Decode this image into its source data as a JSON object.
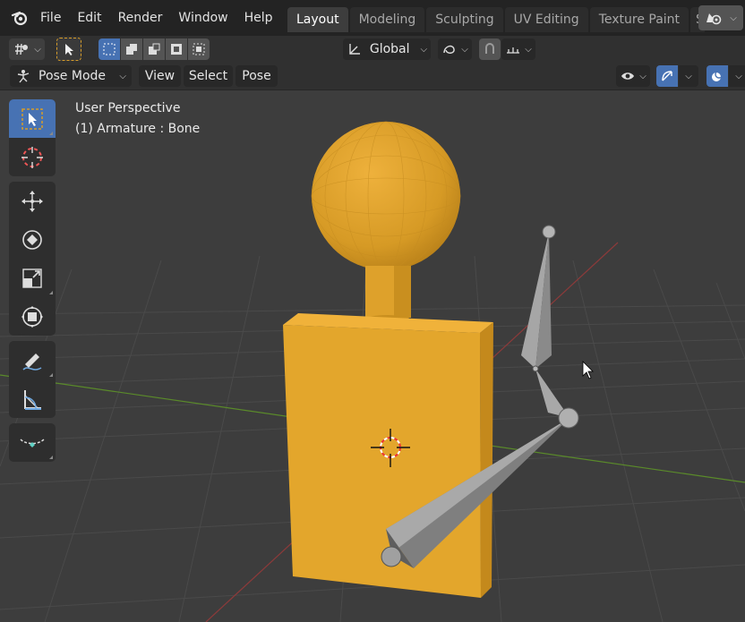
{
  "menu": {
    "file": "File",
    "edit": "Edit",
    "render": "Render",
    "window": "Window",
    "help": "Help"
  },
  "workspaces": [
    {
      "label": "Layout",
      "active": true
    },
    {
      "label": "Modeling"
    },
    {
      "label": "Sculpting"
    },
    {
      "label": "UV Editing"
    },
    {
      "label": "Texture Paint"
    },
    {
      "label": "S"
    }
  ],
  "header": {
    "transform_orientation": "Global",
    "mode": "Pose Mode",
    "view": "View",
    "select": "Select",
    "pose": "Pose"
  },
  "viewport": {
    "perspective": "User Perspective",
    "object_info": "(1) Armature : Bone"
  },
  "colors": {
    "accent": "#4772b3",
    "object": "#e3a62c",
    "bone": "#9d9d9d",
    "background": "#3d3d3d"
  },
  "icons": [
    "blender-logo-icon",
    "editor-type-icon",
    "select-tool-icon",
    "select-mode-icons",
    "transform-pivot-icon",
    "snap-icon",
    "proportional-edit-icon",
    "visibility-icon",
    "gizmo-icon",
    "overlay-icon",
    "cursor-icon",
    "move-icon",
    "rotate-icon",
    "scale-icon",
    "transform-icon",
    "annotate-icon",
    "measure-icon",
    "relax-icon"
  ]
}
